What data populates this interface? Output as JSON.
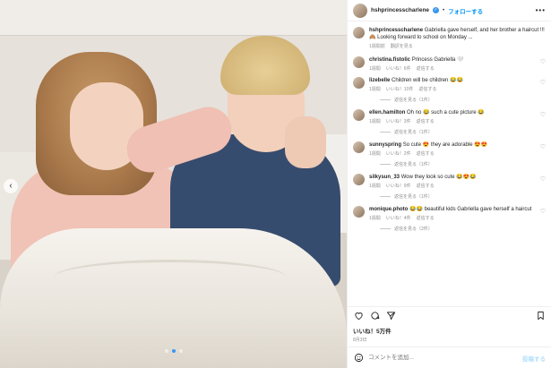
{
  "post": {
    "username": "hshprincesscharlene",
    "follow_label": "フォローする",
    "more_label": "•••",
    "caption": {
      "username": "hshprincesscharlene",
      "text": "Gabriella gave herself, and her brother a haircut !!! 🙈 Looking forward to school on Monday ...",
      "time": "1週間前",
      "translate": "翻訳を見る"
    },
    "comments": [
      {
        "username": "christina.fistolic",
        "text": "Princess Gabriella 🤍",
        "time": "1週間",
        "likes": "いいね！6件",
        "reply": "返信する",
        "view_replies": ""
      },
      {
        "username": "lizebelle",
        "text": "Children will be children 😂😂",
        "time": "1週間",
        "likes": "いいね！10件",
        "reply": "返信する",
        "view_replies": "返信を見る（1件）"
      },
      {
        "username": "ellen.hamilton",
        "text": "Oh no 😂 such a cute picture 😂",
        "time": "1週間",
        "likes": "いいね！3件",
        "reply": "返信する",
        "view_replies": "返信を見る（1件）"
      },
      {
        "username": "sunnyspring",
        "text": "So cute 😍 they are adorable 😍😍",
        "time": "1週間",
        "likes": "いいね！2件",
        "reply": "返信する",
        "view_replies": "返信を見る（1件）"
      },
      {
        "username": "silkysun_33",
        "text": "Wow they look so cute 😂😍😂",
        "time": "1週間",
        "likes": "いいね！9件",
        "reply": "返信する",
        "view_replies": "返信を見る（1件）"
      },
      {
        "username": "monique.photo",
        "text": "😂😂 beautiful kids Gabriella gave herself a haircut",
        "time": "1週間",
        "likes": "いいね！4件",
        "reply": "返信する",
        "view_replies": "返信を見る（2件）"
      }
    ],
    "likes_text": "いいね！5万件",
    "date": "8月3日",
    "comment_placeholder": "コメントを追加...",
    "post_button": "投稿する"
  },
  "icons": {
    "verified": "✓",
    "heart": "♡",
    "prev": "‹"
  }
}
